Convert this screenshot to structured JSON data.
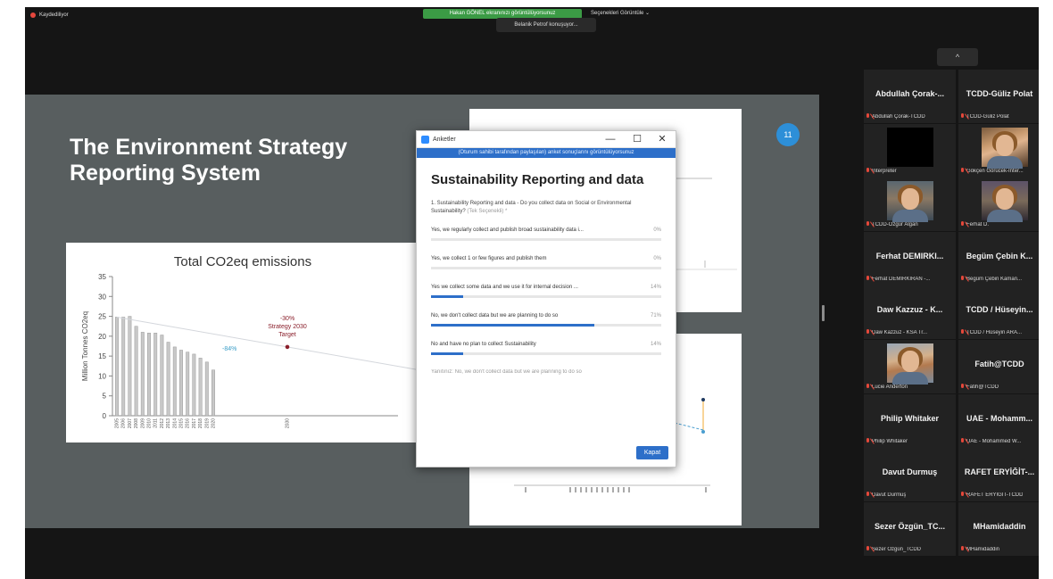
{
  "status": {
    "recording": "Kaydediliyor"
  },
  "share_notice": "Hakan GÖNEL ekranınızı görüntülüyorsunuz",
  "speaking_tip": "Belanik Petrof konuşuyor...",
  "view_options": "Seçenekleri Görüntüle ⌄",
  "slide": {
    "title": "The Environment Strategy\nReporting System",
    "page_number": "11"
  },
  "chart_data": {
    "type": "bar",
    "title": "Total CO2eq emissions",
    "ylabel": "Million Tonnes CO2eq",
    "ylim": [
      0,
      35
    ],
    "yticks": [
      "0",
      "5",
      "10",
      "15",
      "20",
      "25",
      "30",
      "35"
    ],
    "categories": [
      "2005",
      "2006",
      "2007",
      "2008",
      "2009",
      "2010",
      "2011",
      "2012",
      "2013",
      "2014",
      "2015",
      "2016",
      "2017",
      "2018",
      "2019",
      "2020",
      "2030"
    ],
    "values": [
      24.8,
      24.8,
      25.0,
      22.5,
      21.0,
      20.8,
      20.8,
      20.3,
      18.5,
      17.3,
      16.5,
      16.0,
      15.5,
      14.5,
      13.5,
      11.5,
      null
    ],
    "annotations": [
      {
        "text": "-30%\nStrategy 2030\nTarget",
        "x": "2030",
        "y": 17.3,
        "color": "#8a1f2b"
      },
      {
        "text": "-84%",
        "x": "2020",
        "y": 17,
        "color": "#3a9ec7"
      }
    ]
  },
  "poll": {
    "window_title": "Anketler",
    "window_buttons": {
      "minimize": "—",
      "maximize": "☐",
      "close": "✕"
    },
    "banner": "(Oturum sahibi tarafından paylaşılan) anket sonuçlarını görüntülüyorsunuz",
    "heading": "Sustainability Reporting and data",
    "question": "1. Sustainability Reporting and data - Do you collect data on Social or Environmental Sustainability?",
    "question_note": "(Tek Seçenekli) *",
    "options": [
      {
        "label": "Yes, we regularly collect and publish broad sustainability data i...",
        "pct": "0%",
        "value": 0
      },
      {
        "label": "Yes, we collect 1 or few figures and publish them",
        "pct": "0%",
        "value": 0
      },
      {
        "label": "Yes we collect some data and we use it for internal decision ...",
        "pct": "14%",
        "value": 14
      },
      {
        "label": "No, we don't collect data but we are planning to do so",
        "pct": "71%",
        "value": 71
      },
      {
        "label": "No and have no plan to collect Sustainability",
        "pct": "14%",
        "value": 14
      }
    ],
    "answer": "Yanıtınız: No, we don't collect data but we are planning to do so",
    "close_label": "Kapat"
  },
  "gallery": {
    "scroll_up": "^",
    "tiles": [
      {
        "name": "Abdullah Çorak-...",
        "label": "Abdullah Çorak-TCDD",
        "video": ""
      },
      {
        "name": "TCDD-Güliz Polat",
        "label": "TCDD-Güliz Polat",
        "video": ""
      },
      {
        "name": "",
        "label": "Interpreter",
        "video": "black"
      },
      {
        "name": "",
        "label": "Gökçen Görücek-Inter...",
        "video": "woman1"
      },
      {
        "name": "",
        "label": "TCDD-Özgür Algan",
        "video": "man1"
      },
      {
        "name": "",
        "label": "Ferhat D.",
        "video": "man2"
      },
      {
        "name": "Ferhat DEMIRKI...",
        "label": "Ferhat DEMIRKIRAN -...",
        "video": ""
      },
      {
        "name": "Begüm Çebin K...",
        "label": "Begüm Çebin Kaman...",
        "video": ""
      },
      {
        "name": "Daw Kazzuz - K...",
        "label": "Daw Kazzuz - KSA Tr...",
        "video": ""
      },
      {
        "name": "TCDD / Hüseyin...",
        "label": "TCDD / Hüseyin ARA...",
        "video": ""
      },
      {
        "name": "",
        "label": "Lucie Anderton",
        "video": "woman2"
      },
      {
        "name": "Fatih@TCDD",
        "label": "Fatih@TCDD",
        "video": ""
      },
      {
        "name": "Philip Whitaker",
        "label": "Philip Whitaker",
        "video": ""
      },
      {
        "name": "UAE - Mohamm...",
        "label": "UAE - Mohammed W...",
        "video": ""
      },
      {
        "name": "Davut Durmuş",
        "label": "Davut Durmuş",
        "video": ""
      },
      {
        "name": "RAFET ERYİĞİT-...",
        "label": "RAFET ERYİĞİT-TCDD",
        "video": ""
      },
      {
        "name": "Sezer Özgün_TC...",
        "label": "Sezer Özgün_TCDD",
        "video": ""
      },
      {
        "name": "MHamidaddin",
        "label": "MHamidaddin",
        "video": ""
      }
    ]
  },
  "colors": {
    "accent": "#2d6fc9",
    "slide_bg": "#585e5f",
    "share_green": "#3b9b45",
    "muted_mic": "#e5483a"
  }
}
